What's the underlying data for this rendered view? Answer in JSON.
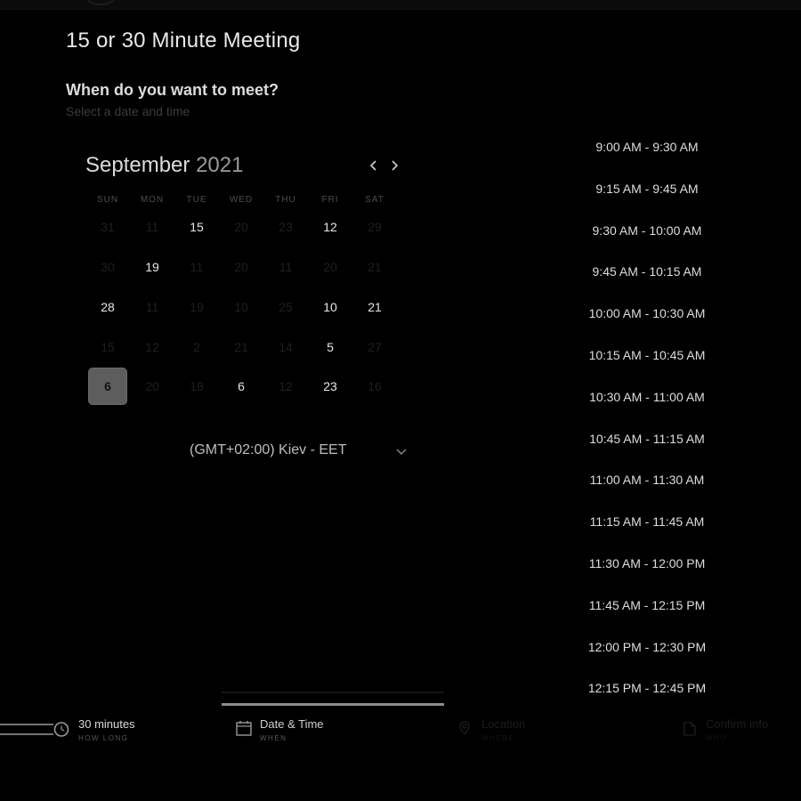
{
  "page": {
    "title": "15 or 30 Minute Meeting",
    "heading": "When do you want to meet?",
    "subheading": "Select a date and time"
  },
  "calendar": {
    "month": "September",
    "year": "2021",
    "weekdays": [
      "SUN",
      "MON",
      "TUE",
      "WED",
      "THU",
      "FRI",
      "SAT"
    ],
    "rows": [
      [
        {
          "d": "31",
          "on": false
        },
        {
          "d": "11",
          "on": false
        },
        {
          "d": "15",
          "on": true
        },
        {
          "d": "20",
          "on": false
        },
        {
          "d": "23",
          "on": false
        },
        {
          "d": "12",
          "on": true
        },
        {
          "d": "29",
          "on": false
        }
      ],
      [
        {
          "d": "30",
          "on": false
        },
        {
          "d": "19",
          "on": true
        },
        {
          "d": "11",
          "on": false
        },
        {
          "d": "20",
          "on": false
        },
        {
          "d": "11",
          "on": false
        },
        {
          "d": "20",
          "on": false
        },
        {
          "d": "21",
          "on": false
        }
      ],
      [
        {
          "d": "28",
          "on": true
        },
        {
          "d": "11",
          "on": false
        },
        {
          "d": "19",
          "on": false
        },
        {
          "d": "10",
          "on": false
        },
        {
          "d": "25",
          "on": false
        },
        {
          "d": "10",
          "on": true
        },
        {
          "d": "21",
          "on": true
        }
      ],
      [
        {
          "d": "15",
          "on": false
        },
        {
          "d": "12",
          "on": false
        },
        {
          "d": "2",
          "on": false
        },
        {
          "d": "21",
          "on": false
        },
        {
          "d": "14",
          "on": false
        },
        {
          "d": "5",
          "on": true
        },
        {
          "d": "27",
          "on": false
        }
      ],
      [
        {
          "d": "6",
          "on": true,
          "selected": true
        },
        {
          "d": "20",
          "on": false
        },
        {
          "d": "18",
          "on": false
        },
        {
          "d": "6",
          "on": true
        },
        {
          "d": "12",
          "on": false
        },
        {
          "d": "23",
          "on": true
        },
        {
          "d": "16",
          "on": false
        }
      ]
    ]
  },
  "timezone": {
    "label": "(GMT+02:00) Kiev - EET"
  },
  "time_slots": [
    "9:00 AM - 9:30 AM",
    "9:15 AM - 9:45 AM",
    "9:30 AM - 10:00 AM",
    "9:45 AM - 10:15 AM",
    "10:00 AM - 10:30 AM",
    "10:15 AM - 10:45 AM",
    "10:30 AM - 11:00 AM",
    "10:45 AM - 11:15 AM",
    "11:00 AM - 11:30 AM",
    "11:15 AM - 11:45 AM",
    "11:30 AM - 12:00 PM",
    "11:45 AM - 12:15 PM",
    "12:00 PM - 12:30 PM",
    "12:15 PM - 12:45 PM"
  ],
  "steps": {
    "duration": {
      "label": "30 minutes",
      "sub": "HOW LONG"
    },
    "datetime": {
      "label": "Date & Time",
      "sub": "WHEN"
    },
    "location": {
      "label": "Location",
      "sub": "WHERE"
    },
    "confirm": {
      "label": "Confirm info",
      "sub": "WHO"
    }
  },
  "colors": {
    "background": "#000000",
    "selected_day": "#5d5d5d",
    "progress": "#8c8c8c"
  }
}
